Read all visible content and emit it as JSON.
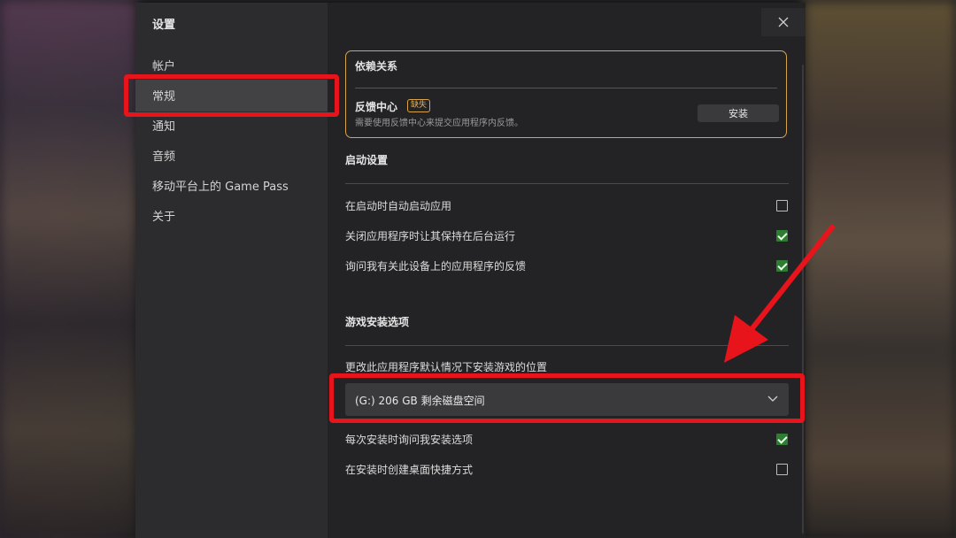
{
  "sidebar": {
    "title": "设置",
    "items": [
      {
        "label": "帐户"
      },
      {
        "label": "常规"
      },
      {
        "label": "通知"
      },
      {
        "label": "音频"
      },
      {
        "label": "移动平台上的 Game Pass"
      },
      {
        "label": "关于"
      }
    ],
    "selected_index": 1
  },
  "window": {
    "close_icon": "close-icon"
  },
  "dependencies": {
    "title": "依赖关系",
    "feedback_hub": {
      "name": "反馈中心",
      "badge": "缺失",
      "description": "需要使用反馈中心来提交应用程序内反馈。",
      "install_label": "安装"
    }
  },
  "startup": {
    "title": "启动设置",
    "options": [
      {
        "label": "在启动时自动启动应用",
        "checked": false
      },
      {
        "label": "关闭应用程序时让其保持在后台运行",
        "checked": true
      },
      {
        "label": "询问我有关此设备上的应用程序的反馈",
        "checked": true
      }
    ]
  },
  "game_install": {
    "title": "游戏安装选项",
    "location_label": "更改此应用程序默认情况下安装游戏的位置",
    "location_value": "(G:) 206 GB 剩余磁盘空间",
    "options": [
      {
        "label": "每次安装时询问我安装选项",
        "checked": true
      },
      {
        "label": "在安装时创建桌面快捷方式",
        "checked": false
      }
    ]
  },
  "colors": {
    "accent_border": "#d9a447",
    "checkbox_checked": "#2e7d32",
    "annotation_red": "#e8141b"
  }
}
